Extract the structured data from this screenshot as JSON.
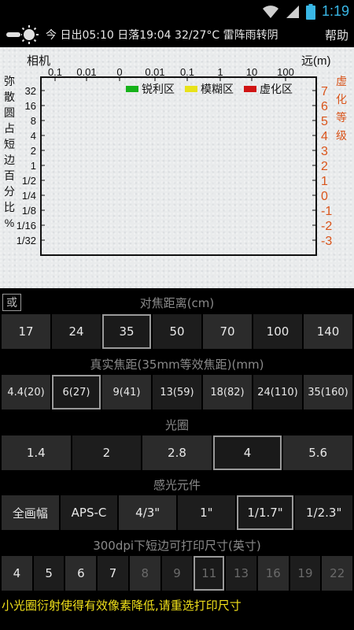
{
  "status_bar": {
    "time": "1:19",
    "icons": [
      "wifi-icon",
      "signal-icon",
      "battery-icon"
    ]
  },
  "title_bar": {
    "icon": "sun-icon",
    "info": "今 日出05:10 日落19:04 32/27°C 雷阵雨转阴",
    "help_label": "帮助"
  },
  "chart": {
    "top_left_label": "相机",
    "top_right_label": "远(m)",
    "x_ticks": [
      "0.1",
      "0.01",
      "0",
      "0.01",
      "0.1",
      "1",
      "10",
      "100"
    ],
    "y_left_title": "弥散圆占短边百分比%",
    "y_left_ticks": [
      "32",
      "16",
      "8",
      "4",
      "2",
      "1",
      "1/2",
      "1/4",
      "1/8",
      "1/16",
      "1/32"
    ],
    "y_right_title": "虚化等级",
    "y_right_ticks": [
      "7",
      "6",
      "5",
      "4",
      "3",
      "2",
      "1",
      "0",
      "-1",
      "-2",
      "-3"
    ],
    "legend": [
      {
        "label": "锐利区",
        "color": "#16b21a"
      },
      {
        "label": "模糊区",
        "color": "#e8e21a"
      },
      {
        "label": "虚化区",
        "color": "#d01414"
      }
    ],
    "colors": {
      "right_axis": "#d9541a",
      "frame": "#111111"
    }
  },
  "or_label": "或",
  "focus_distance": {
    "title": "对焦距离(cm)",
    "options": [
      "17",
      "24",
      "35",
      "50",
      "70",
      "100",
      "140"
    ],
    "selected": "35"
  },
  "focal_length": {
    "title": "真实焦距(35mm等效焦距)(mm)",
    "options": [
      "4.4(20)",
      "6(27)",
      "9(41)",
      "13(59)",
      "18(82)",
      "24(110)",
      "35(160)"
    ],
    "selected": "6(27)"
  },
  "aperture": {
    "title": "光圈",
    "options": [
      "1.4",
      "2",
      "2.8",
      "4",
      "5.6"
    ],
    "selected": "4"
  },
  "sensor": {
    "title": "感光元件",
    "options": [
      "全画幅",
      "APS-C",
      "4/3\"",
      "1\"",
      "1/1.7\"",
      "1/2.3\""
    ],
    "selected": "1/1.7\""
  },
  "print_size": {
    "title": "300dpi下短边可打印尺寸(英寸)",
    "options": [
      "4",
      "5",
      "6",
      "7",
      "8",
      "9",
      "11",
      "13",
      "16",
      "19",
      "22"
    ],
    "selected": "11",
    "dimmed": [
      "8",
      "9",
      "11",
      "13",
      "16",
      "19",
      "22"
    ]
  },
  "warning": "小光圈衍射使得有效像素降低,请重选打印尺寸",
  "colors": {
    "warning": "#f0e01a",
    "selection_border": "#9a9a9a",
    "time": "#39b7e6"
  }
}
